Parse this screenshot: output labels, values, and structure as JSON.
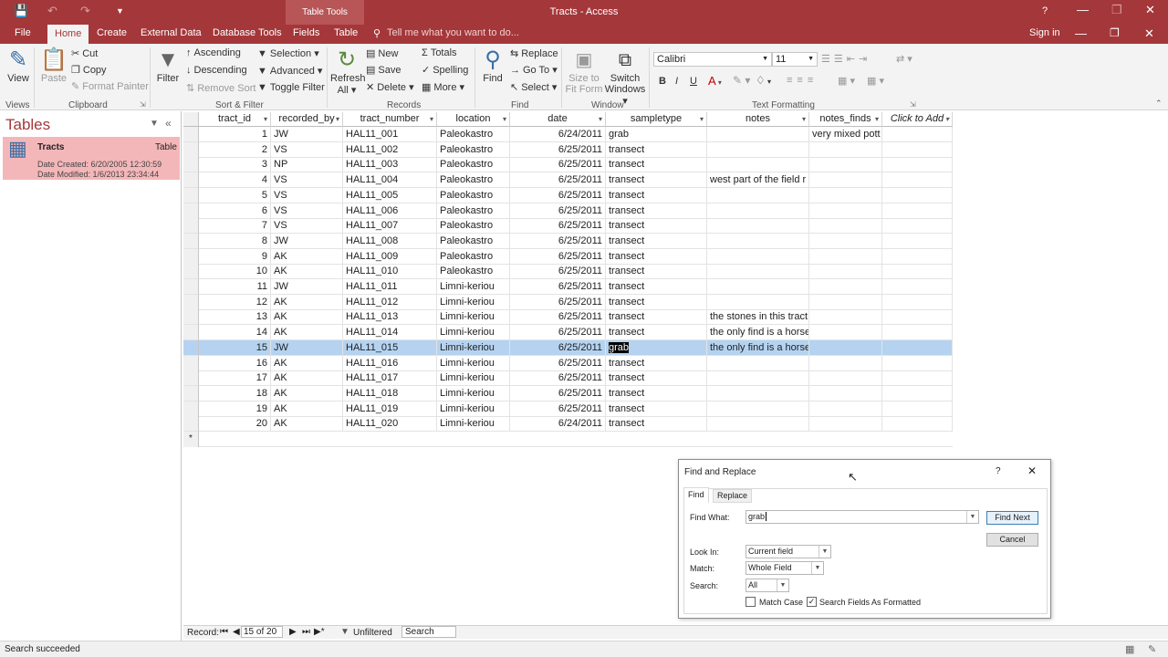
{
  "window": {
    "title": "Tracts - Access",
    "context_tab": "Table Tools",
    "tell_me": "Tell me what you want to do...",
    "sign_in": "Sign in",
    "help": "?"
  },
  "tabs": [
    "File",
    "Home",
    "Create",
    "External Data",
    "Database Tools",
    "Fields",
    "Table"
  ],
  "ribbon": {
    "views": {
      "view": "View",
      "group": "Views"
    },
    "clipboard": {
      "paste": "Paste",
      "cut": "Cut",
      "copy": "Copy",
      "format_painter": "Format Painter",
      "group": "Clipboard"
    },
    "sort_filter": {
      "filter": "Filter",
      "ascending": "Ascending",
      "descending": "Descending",
      "remove_sort": "Remove Sort",
      "selection": "Selection",
      "advanced": "Advanced",
      "toggle_filter": "Toggle Filter",
      "group": "Sort & Filter"
    },
    "records": {
      "refresh": "Refresh",
      "refresh_all": "All",
      "new": "New",
      "save": "Save",
      "delete": "Delete",
      "totals": "Totals",
      "spelling": "Spelling",
      "more": "More",
      "group": "Records"
    },
    "find": {
      "find": "Find",
      "replace": "Replace",
      "goto": "Go To",
      "select": "Select",
      "group": "Find"
    },
    "window": {
      "size_to": "Size to",
      "fit_form": "Fit Form",
      "switch": "Switch",
      "windows": "Windows",
      "group": "Window"
    },
    "text": {
      "font": "Calibri",
      "size": "11",
      "group": "Text Formatting"
    }
  },
  "nav": {
    "title": "Tables",
    "item": {
      "name": "Tracts",
      "type": "Table",
      "created": "Date Created: 6/20/2005 12:30:59",
      "modified": "Date Modified: 1/6/2013 23:34:44"
    }
  },
  "columns": [
    "tract_id",
    "recorded_by",
    "tract_number",
    "location",
    "date",
    "sampletype",
    "notes",
    "notes_finds",
    "Click to Add"
  ],
  "rows": [
    [
      "1",
      "JW",
      "HAL11_001",
      "Paleokastro",
      "6/24/2011",
      "grab",
      "",
      "very mixed pott"
    ],
    [
      "2",
      "VS",
      "HAL11_002",
      "Paleokastro",
      "6/25/2011",
      "transect",
      "",
      ""
    ],
    [
      "3",
      "NP",
      "HAL11_003",
      "Paleokastro",
      "6/25/2011",
      "transect",
      "",
      ""
    ],
    [
      "4",
      "VS",
      "HAL11_004",
      "Paleokastro",
      "6/25/2011",
      "transect",
      "west part of the field r",
      ""
    ],
    [
      "5",
      "VS",
      "HAL11_005",
      "Paleokastro",
      "6/25/2011",
      "transect",
      "",
      ""
    ],
    [
      "6",
      "VS",
      "HAL11_006",
      "Paleokastro",
      "6/25/2011",
      "transect",
      "",
      ""
    ],
    [
      "7",
      "VS",
      "HAL11_007",
      "Paleokastro",
      "6/25/2011",
      "transect",
      "",
      ""
    ],
    [
      "8",
      "JW",
      "HAL11_008",
      "Paleokastro",
      "6/25/2011",
      "transect",
      "",
      ""
    ],
    [
      "9",
      "AK",
      "HAL11_009",
      "Paleokastro",
      "6/25/2011",
      "transect",
      "",
      ""
    ],
    [
      "10",
      "AK",
      "HAL11_010",
      "Paleokastro",
      "6/25/2011",
      "transect",
      "",
      ""
    ],
    [
      "11",
      "JW",
      "HAL11_011",
      "Limni-keriou",
      "6/25/2011",
      "transect",
      "",
      ""
    ],
    [
      "12",
      "AK",
      "HAL11_012",
      "Limni-keriou",
      "6/25/2011",
      "transect",
      "",
      ""
    ],
    [
      "13",
      "AK",
      "HAL11_013",
      "Limni-keriou",
      "6/25/2011",
      "transect",
      "the stones in this tract",
      ""
    ],
    [
      "14",
      "AK",
      "HAL11_014",
      "Limni-keriou",
      "6/25/2011",
      "transect",
      "the only find is a horse",
      ""
    ],
    [
      "15",
      "JW",
      "HAL11_015",
      "Limni-keriou",
      "6/25/2011",
      "grab",
      "the only find is a horse",
      ""
    ],
    [
      "16",
      "AK",
      "HAL11_016",
      "Limni-keriou",
      "6/25/2011",
      "transect",
      "",
      ""
    ],
    [
      "17",
      "AK",
      "HAL11_017",
      "Limni-keriou",
      "6/25/2011",
      "transect",
      "",
      ""
    ],
    [
      "18",
      "AK",
      "HAL11_018",
      "Limni-keriou",
      "6/25/2011",
      "transect",
      "",
      ""
    ],
    [
      "19",
      "AK",
      "HAL11_019",
      "Limni-keriou",
      "6/25/2011",
      "transect",
      "",
      ""
    ],
    [
      "20",
      "AK",
      "HAL11_020",
      "Limni-keriou",
      "6/24/2011",
      "transect",
      "",
      ""
    ]
  ],
  "record_nav": {
    "label": "Record:",
    "position": "15 of 20",
    "filter": "Unfiltered",
    "search": "Search"
  },
  "status": {
    "text": "Search succeeded"
  },
  "dialog": {
    "title": "Find and Replace",
    "help": "?",
    "tab_find": "Find",
    "tab_replace": "Replace",
    "find_what_label": "Find What:",
    "find_what_value": "grab",
    "find_next": "Find Next",
    "cancel": "Cancel",
    "look_in_label": "Look In:",
    "look_in_value": "Current field",
    "match_label": "Match:",
    "match_value": "Whole Field",
    "search_label": "Search:",
    "search_value": "All",
    "match_case": "Match Case",
    "search_formatted": "Search Fields As Formatted"
  },
  "colors": {
    "accent": "#a4373a",
    "highlight_row": "#b5d3f1",
    "nav_item": "#f4b7b9"
  }
}
